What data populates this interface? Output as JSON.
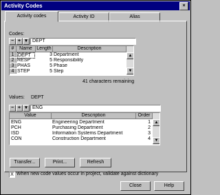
{
  "window": {
    "title": "Activity Codes",
    "close_glyph": "×"
  },
  "tabs": [
    {
      "label": "Activity codes"
    },
    {
      "label": "Activity ID"
    },
    {
      "label": "Alias"
    }
  ],
  "codes": {
    "label": "Codes:",
    "current_value": "DEPT",
    "headers": [
      "#",
      "Name",
      "Length",
      "Description"
    ],
    "rows": [
      {
        "num": "1",
        "name": "DEPT",
        "length": "3",
        "description": "Department"
      },
      {
        "num": "2",
        "name": "RESP",
        "length": "5",
        "description": "Responsibility"
      },
      {
        "num": "3",
        "name": "PHAS",
        "length": "5",
        "description": "Phase"
      },
      {
        "num": "4",
        "name": "STEP",
        "length": "5",
        "description": "Step"
      }
    ],
    "remaining": "41 characters remaining"
  },
  "values": {
    "label": "Values:",
    "code_name": "DEPT",
    "current_value": "ENG",
    "headers": [
      "Value",
      "Description",
      "Order"
    ],
    "rows": [
      {
        "value": "ENG",
        "description": "Engineering Department",
        "order": "1"
      },
      {
        "value": "PCH",
        "description": "Purchasing Department",
        "order": "2"
      },
      {
        "value": "ISD",
        "description": "Information Systems Department",
        "order": "3"
      },
      {
        "value": "CON",
        "description": "Construction Department",
        "order": "4"
      }
    ]
  },
  "toolbar": {
    "minus": "−",
    "plus": "+",
    "dropdown": "▾"
  },
  "buttons": {
    "transfer": "Transfer...",
    "print": "Print...",
    "refresh": "Refresh",
    "close": "Close",
    "help": "Help"
  },
  "validate": {
    "checked": true,
    "mark": "X",
    "label": "When new code values occur in project, validate against dictionary"
  }
}
